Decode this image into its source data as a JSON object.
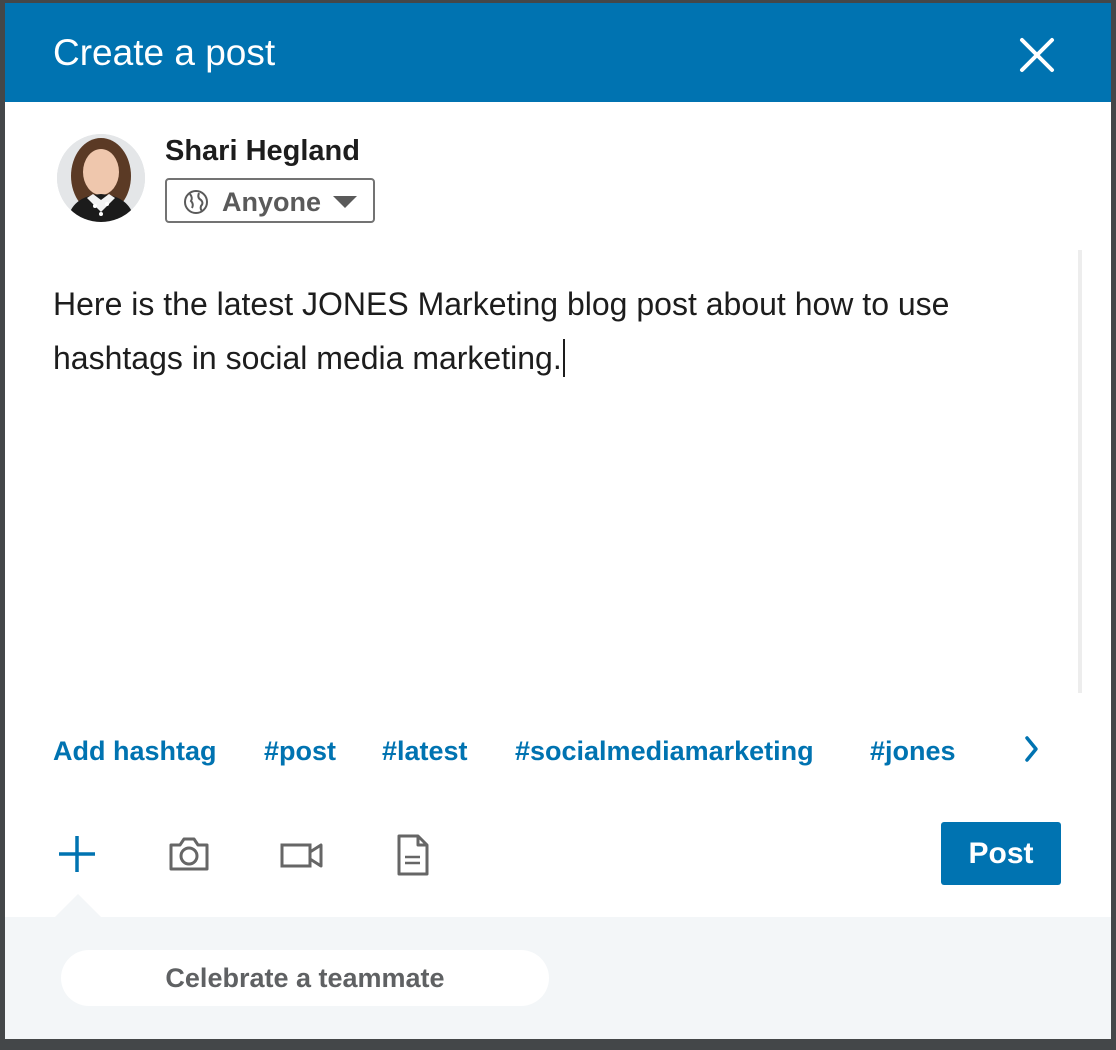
{
  "header": {
    "title": "Create a post",
    "close_icon": "close-icon"
  },
  "author": {
    "name": "Shari Hegland",
    "visibility": {
      "selected": "Anyone",
      "icon": "globe-icon"
    }
  },
  "editor": {
    "text": "Here is the latest JONES Marketing blog post about how to use hashtags in social media marketing."
  },
  "hashtags": {
    "add_label": "Add hashtag",
    "suggestions": [
      "#post",
      "#latest",
      "#socialmediamarketing",
      "#jones"
    ],
    "more_icon": "chevron-right-icon"
  },
  "toolbar": {
    "icons": [
      "plus-icon",
      "camera-icon",
      "video-icon",
      "document-icon"
    ],
    "post_label": "Post"
  },
  "footer": {
    "celebrate_label": "Celebrate a teammate"
  },
  "colors": {
    "brand": "#0073b1",
    "background": "#f3f6f8"
  }
}
